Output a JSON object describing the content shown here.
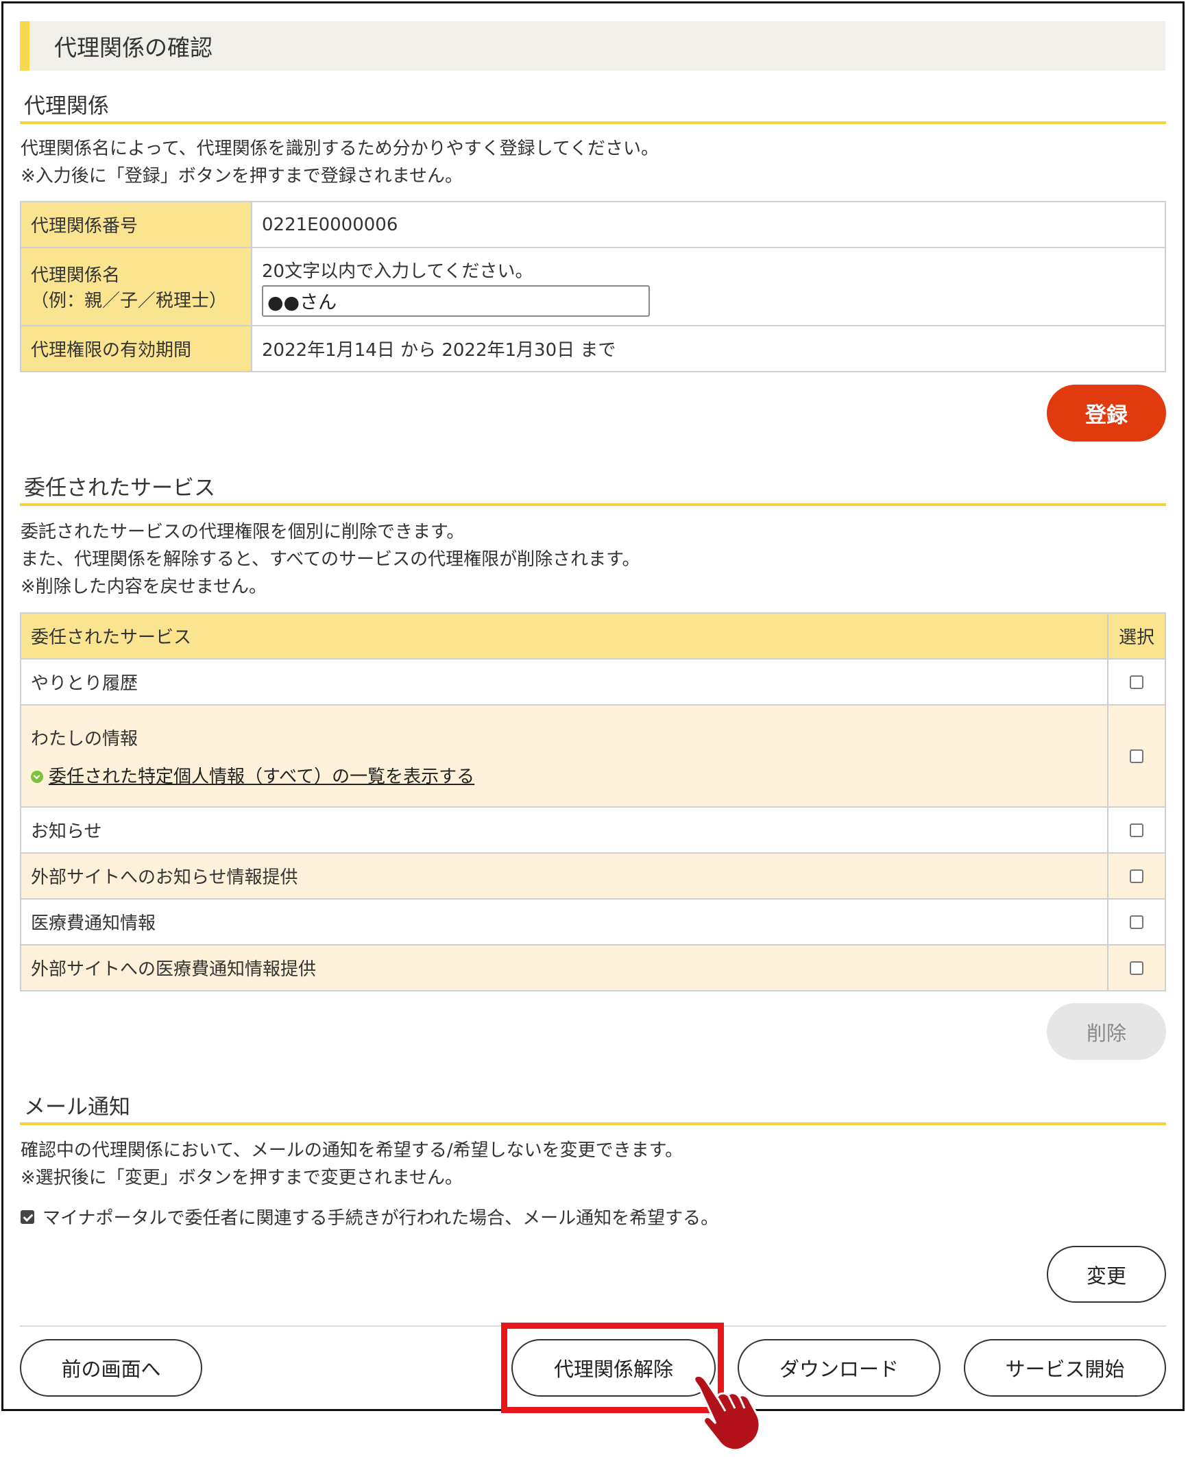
{
  "page_title": "代理関係の確認",
  "relationship": {
    "heading": "代理関係",
    "desc_line1": "代理関係名によって、代理関係を識別するため分かりやすく登録してください。",
    "desc_line2": "※入力後に「登録」ボタンを押すまで登録されません。",
    "number_label": "代理関係番号",
    "number_value": "0221E0000006",
    "name_label_line1": "代理関係名",
    "name_label_line2": "（例：親／子／税理士）",
    "name_hint": "20文字以内で入力してください。",
    "name_value": "●●さん",
    "period_label": "代理権限の有効期間",
    "period_value": "2022年1月14日 から 2022年1月30日 まで",
    "register_button": "登録"
  },
  "services": {
    "heading": "委任されたサービス",
    "desc_line1": "委託されたサービスの代理権限を個別に削除できます。",
    "desc_line2": "また、代理関係を解除すると、すべてのサービスの代理権限が削除されます。",
    "desc_line3": "※削除した内容を戻せません。",
    "col_service": "委任されたサービス",
    "col_select": "選択",
    "rows": [
      {
        "label": "やりとり履歴",
        "checked": false
      },
      {
        "label": "わたしの情報",
        "link": "委任された特定個人情報（すべて）の一覧を表示する",
        "checked": false
      },
      {
        "label": "お知らせ",
        "checked": false
      },
      {
        "label": "外部サイトへのお知らせ情報提供",
        "checked": false
      },
      {
        "label": "医療費通知情報",
        "checked": false
      },
      {
        "label": "外部サイトへの医療費通知情報提供",
        "checked": false
      }
    ],
    "delete_button": "削除"
  },
  "mail": {
    "heading": "メール通知",
    "desc_line1": "確認中の代理関係において、メールの通知を希望する/希望しないを変更できます。",
    "desc_line2": "※選択後に「変更」ボタンを押すまで変更されません。",
    "checkbox_label": "マイナポータルで委任者に関連する手続きが行われた場合、メール通知を希望する。",
    "checkbox_checked": true,
    "change_button": "変更"
  },
  "footer": {
    "back_button": "前の画面へ",
    "release_button": "代理関係解除",
    "download_button": "ダウンロード",
    "start_button": "サービス開始"
  },
  "colors": {
    "accent_yellow": "#f3d23c",
    "header_cell": "#fbe48f",
    "alt_row": "#fdf2d9",
    "register_red": "#e03a0e",
    "highlight_red": "#e8161b",
    "hand_red": "#b4121a"
  }
}
